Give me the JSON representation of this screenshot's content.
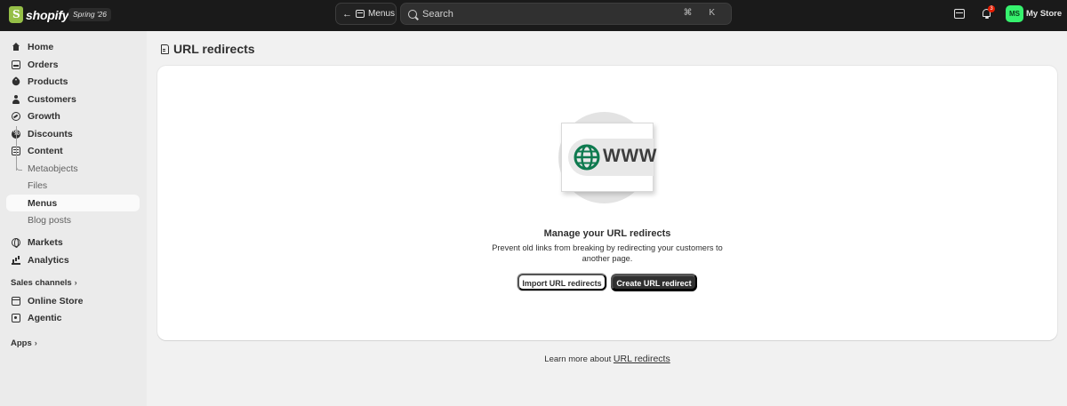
{
  "topbar": {
    "brand": "shopify",
    "release_badge": "Spring '26",
    "back_label": "Menus",
    "search_placeholder": "Search",
    "search_shortcut": "⌘ K",
    "notification_count": "3",
    "avatar_initials": "MS",
    "store_name": "My Store"
  },
  "sidebar": {
    "items": [
      {
        "label": "Home",
        "icon": "home-icon"
      },
      {
        "label": "Orders",
        "icon": "orders-icon"
      },
      {
        "label": "Products",
        "icon": "tag-icon"
      },
      {
        "label": "Customers",
        "icon": "person-icon"
      },
      {
        "label": "Growth",
        "icon": "growth-icon"
      },
      {
        "label": "Discounts",
        "icon": "discount-icon"
      },
      {
        "label": "Content",
        "icon": "content-icon"
      }
    ],
    "content_sub": [
      {
        "label": "Metaobjects"
      },
      {
        "label": "Files"
      },
      {
        "label": "Menus",
        "active": true
      },
      {
        "label": "Blog posts"
      }
    ],
    "items2": [
      {
        "label": "Markets",
        "icon": "globe-icon"
      },
      {
        "label": "Analytics",
        "icon": "chart-icon"
      }
    ],
    "sales_channels_label": "Sales channels",
    "channels": [
      {
        "label": "Online Store",
        "icon": "store-icon"
      },
      {
        "label": "Agentic",
        "icon": "agent-icon"
      }
    ],
    "apps_label": "Apps"
  },
  "main": {
    "title": "URL redirects",
    "illustration_text": "WWW",
    "empty_title": "Manage your URL redirects",
    "empty_description": "Prevent old links from breaking by redirecting your customers to another page.",
    "import_button": "Import URL redirects",
    "create_button": "Create URL redirect",
    "help_prefix": "Learn more about",
    "help_link": "URL redirects"
  },
  "colors": {
    "topbar_bg": "#1a1a1a",
    "accent_green": "#36f26e",
    "globe_green": "#0e7a4f",
    "primary_button": "#303030"
  }
}
